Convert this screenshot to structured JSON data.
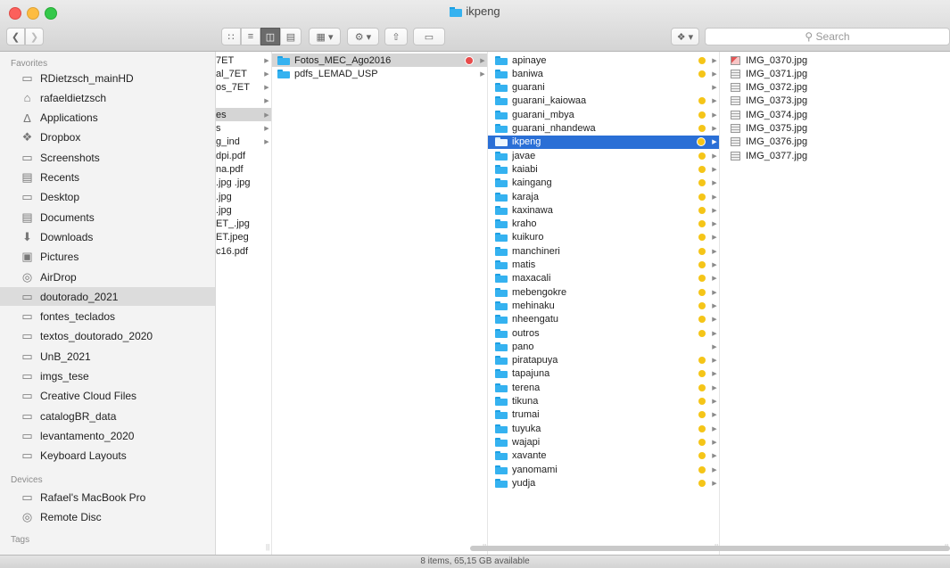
{
  "window": {
    "title": "ikpeng"
  },
  "toolbar": {
    "back_icon": "chevron-left-icon",
    "forward_icon": "chevron-right-icon",
    "view_icons": [
      "icon-view",
      "list-view",
      "column-view",
      "coverflow-view"
    ],
    "group_icon": "group-icon",
    "action_icon": "gear-icon",
    "share_icon": "share-icon",
    "tag_icon": "tag-icon",
    "dropbox_icon": "dropbox-icon",
    "search_placeholder": "Search"
  },
  "sidebar": {
    "favorites_header": "Favorites",
    "favorites": [
      {
        "label": "RDietzsch_mainHD",
        "icon": "disk-icon"
      },
      {
        "label": "rafaeldietzsch",
        "icon": "home-icon"
      },
      {
        "label": "Applications",
        "icon": "applications-icon"
      },
      {
        "label": "Dropbox",
        "icon": "dropbox-icon"
      },
      {
        "label": "Screenshots",
        "icon": "folder-icon"
      },
      {
        "label": "Recents",
        "icon": "recents-icon"
      },
      {
        "label": "Desktop",
        "icon": "desktop-icon"
      },
      {
        "label": "Documents",
        "icon": "documents-icon"
      },
      {
        "label": "Downloads",
        "icon": "downloads-icon"
      },
      {
        "label": "Pictures",
        "icon": "pictures-icon"
      },
      {
        "label": "AirDrop",
        "icon": "airdrop-icon"
      },
      {
        "label": "doutorado_2021",
        "icon": "folder-icon",
        "selected": true
      },
      {
        "label": "fontes_teclados",
        "icon": "folder-icon"
      },
      {
        "label": "textos_doutorado_2020",
        "icon": "folder-icon"
      },
      {
        "label": "UnB_2021",
        "icon": "folder-icon"
      },
      {
        "label": "imgs_tese",
        "icon": "folder-icon"
      },
      {
        "label": "Creative Cloud Files",
        "icon": "folder-icon"
      },
      {
        "label": "catalogBR_data",
        "icon": "folder-icon"
      },
      {
        "label": "levantamento_2020",
        "icon": "folder-icon"
      },
      {
        "label": "Keyboard Layouts",
        "icon": "folder-icon"
      }
    ],
    "devices_header": "Devices",
    "devices": [
      {
        "label": "Rafael's MacBook Pro",
        "icon": "laptop-icon"
      },
      {
        "label": "Remote Disc",
        "icon": "disc-icon"
      }
    ],
    "tags_header": "Tags"
  },
  "column1": [
    {
      "name": "7ET",
      "arrow": true
    },
    {
      "name": "al_7ET",
      "arrow": true
    },
    {
      "name": "os_7ET",
      "arrow": true
    },
    {
      "name": "",
      "arrow": true
    },
    {
      "name": "es",
      "arrow": true,
      "selected": true
    },
    {
      "name": "s",
      "arrow": true
    },
    {
      "name": "g_ind",
      "arrow": true
    },
    {
      "name": "dpi.pdf"
    },
    {
      "name": "na.pdf"
    },
    {
      "name": ".jpg .jpg"
    },
    {
      "name": ".jpg"
    },
    {
      "name": ".jpg"
    },
    {
      "name": "ET_.jpg"
    },
    {
      "name": "ET.jpeg"
    },
    {
      "name": "c16.pdf"
    }
  ],
  "column2": [
    {
      "name": "Fotos_MEC_Ago2016",
      "dot": "#e84b4b",
      "selected": true
    },
    {
      "name": "pdfs_LEMAD_USP"
    }
  ],
  "column3": [
    {
      "name": "apinaye",
      "dot": "#f5c518"
    },
    {
      "name": "baniwa",
      "dot": "#f5c518"
    },
    {
      "name": "guarani",
      "dot": ""
    },
    {
      "name": "guarani_kaiowaa",
      "dot": "#f5c518"
    },
    {
      "name": "guarani_mbya",
      "dot": "#f5c518"
    },
    {
      "name": "guarani_nhandewa",
      "dot": "#f5c518"
    },
    {
      "name": "ikpeng",
      "dot": "#f5c518",
      "selected": true
    },
    {
      "name": "javae",
      "dot": "#f5c518"
    },
    {
      "name": "kaiabi",
      "dot": "#f5c518"
    },
    {
      "name": "kaingang",
      "dot": "#f5c518"
    },
    {
      "name": "karaja",
      "dot": "#f5c518"
    },
    {
      "name": "kaxinawa",
      "dot": "#f5c518"
    },
    {
      "name": "kraho",
      "dot": "#f5c518"
    },
    {
      "name": "kuikuro",
      "dot": "#f5c518"
    },
    {
      "name": "manchineri",
      "dot": "#f5c518"
    },
    {
      "name": "matis",
      "dot": "#f5c518"
    },
    {
      "name": "maxacali",
      "dot": "#f5c518"
    },
    {
      "name": "mebengokre",
      "dot": "#f5c518"
    },
    {
      "name": "mehinaku",
      "dot": "#f5c518"
    },
    {
      "name": "nheengatu",
      "dot": "#f5c518"
    },
    {
      "name": "outros",
      "dot": "#f5c518"
    },
    {
      "name": "pano",
      "dot": ""
    },
    {
      "name": "piratapuya",
      "dot": "#f5c518"
    },
    {
      "name": "tapajuna",
      "dot": "#f5c518"
    },
    {
      "name": "terena",
      "dot": "#f5c518"
    },
    {
      "name": "tikuna",
      "dot": "#f5c518"
    },
    {
      "name": "trumai",
      "dot": "#f5c518"
    },
    {
      "name": "tuyuka",
      "dot": "#f5c518"
    },
    {
      "name": "wajapi",
      "dot": "#f5c518"
    },
    {
      "name": "xavante",
      "dot": "#f5c518"
    },
    {
      "name": "yanomami",
      "dot": "#f5c518"
    },
    {
      "name": "yudja",
      "dot": "#f5c518"
    }
  ],
  "column4": [
    {
      "name": "IMG_0370.jpg",
      "thumb": "red"
    },
    {
      "name": "IMG_0371.jpg"
    },
    {
      "name": "IMG_0372.jpg"
    },
    {
      "name": "IMG_0373.jpg"
    },
    {
      "name": "IMG_0374.jpg"
    },
    {
      "name": "IMG_0375.jpg"
    },
    {
      "name": "IMG_0376.jpg"
    },
    {
      "name": "IMG_0377.jpg"
    }
  ],
  "status": {
    "text": "8 items, 65,15 GB available"
  }
}
